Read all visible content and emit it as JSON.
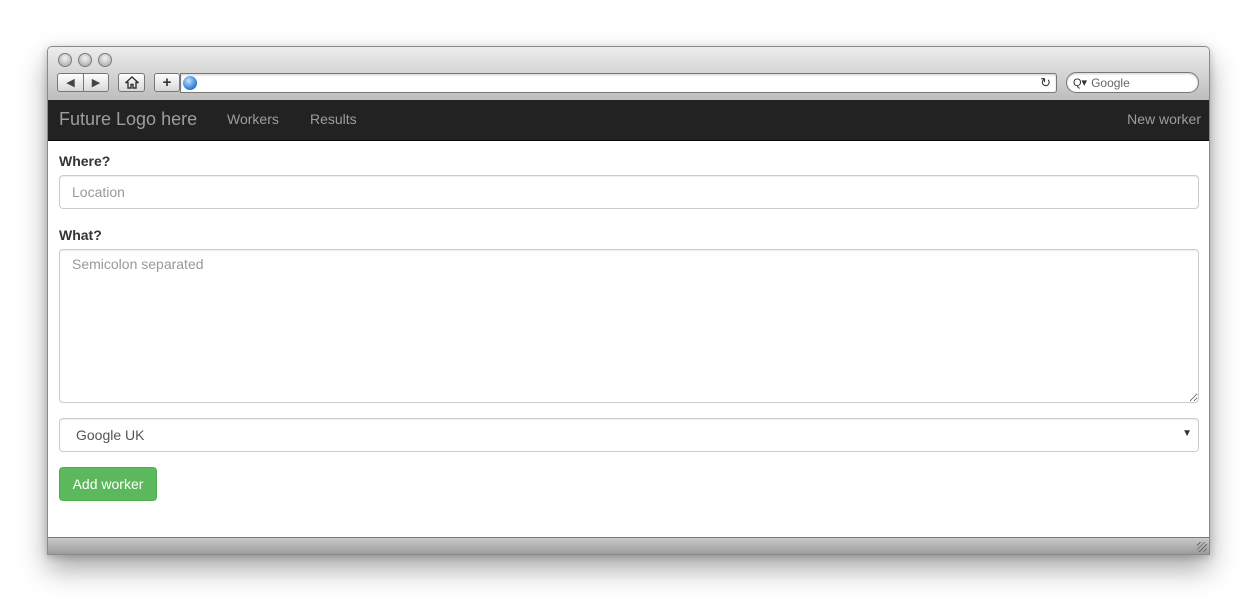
{
  "browser": {
    "url": "",
    "search_placeholder": "Google"
  },
  "navbar": {
    "brand": "Future Logo here",
    "links": [
      "Workers",
      "Results"
    ],
    "right_link": "New worker",
    "background": "#222222"
  },
  "form": {
    "where_label": "Where?",
    "location_placeholder": "Location",
    "what_label": "What?",
    "terms_placeholder": "Semicolon separated",
    "engine_selected": "Google UK",
    "submit_label": "Add worker",
    "submit_color": "#5cb85c"
  },
  "icons": {
    "back": "back-arrow-icon",
    "forward": "forward-arrow-icon",
    "home": "home-icon",
    "new_tab": "plus-icon",
    "site": "globe-icon",
    "reload": "reload-icon",
    "search": "search-icon",
    "select_caret": "caret-down-icon",
    "resize": "resize-grip-icon"
  }
}
